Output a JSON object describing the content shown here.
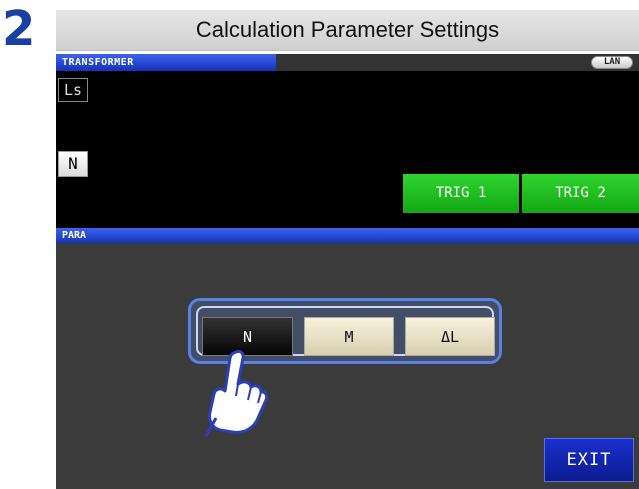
{
  "step_number": "2",
  "title": "Calculation Parameter Settings",
  "header": {
    "mode_label": "TRANSFORMER",
    "lan_badge": "LAN"
  },
  "display": {
    "ls_label": "Ls",
    "n_label": "N"
  },
  "trigger_buttons": [
    "TRIG 1",
    "TRIG 2"
  ],
  "para_section": {
    "label": "PARA",
    "options": [
      {
        "label": "N",
        "selected": true
      },
      {
        "label": "M",
        "selected": false
      },
      {
        "label": "ΔL",
        "selected": false
      }
    ]
  },
  "exit_label": "EXIT",
  "icons": {
    "pointer": "pointing-hand-icon"
  },
  "colors": {
    "header_blue": "#1f44d4",
    "trigger_green": "#22c022",
    "exit_blue": "#1426b0",
    "highlight": "#5a82e6"
  }
}
